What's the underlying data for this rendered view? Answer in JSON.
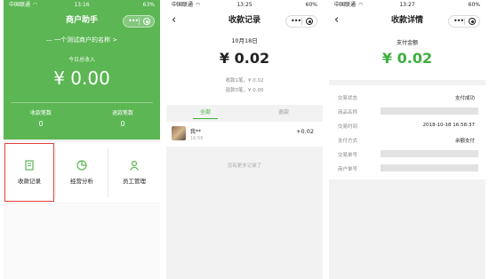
{
  "screen1": {
    "status": {
      "carrier": "中国联通",
      "time": "13:16",
      "battery": "63%"
    },
    "title": "商户助手",
    "merchant_name": "一个测试商户的名称",
    "today_label": "今日总收入",
    "today_amount": "¥ 0.00",
    "stats": [
      {
        "label": "收款笔数",
        "value": "0"
      },
      {
        "label": "退款笔数",
        "value": "0"
      }
    ],
    "menu": [
      {
        "label": "收款记录",
        "icon": "document-icon"
      },
      {
        "label": "经营分析",
        "icon": "pie-chart-icon"
      },
      {
        "label": "员工管理",
        "icon": "person-icon"
      }
    ],
    "accent": "#5bb653",
    "highlight": "#e33b3b"
  },
  "screen2": {
    "status": {
      "carrier": "中国联通",
      "time": "13:25",
      "battery": "60%"
    },
    "title": "收款记录",
    "date": "10月18日",
    "amount": "¥ 0.02",
    "line1": "收款1笔，¥ 0.02",
    "line2": "退款0笔，¥ 0.00",
    "tabs": [
      "全部",
      "退款"
    ],
    "record": {
      "name": "我**",
      "time": "16:58",
      "amount": "+0.02"
    },
    "no_more": "没有更多记录了",
    "accent": "#3eaf3e"
  },
  "screen3": {
    "status": {
      "carrier": "中国联通",
      "time": "13:27",
      "battery": "60%"
    },
    "title": "收款详情",
    "pay_label": "支付金额",
    "pay_amount": "¥ 0.02",
    "rows": [
      {
        "key": "交易状态",
        "value": "支付成功"
      },
      {
        "key": "商品名称",
        "value": ""
      },
      {
        "key": "交易时间",
        "value": "2018-10-18 16:58:37"
      },
      {
        "key": "支付方式",
        "value": "余额支付"
      },
      {
        "key": "交易单号",
        "value": ""
      },
      {
        "key": "商户单号",
        "value": ""
      }
    ]
  }
}
